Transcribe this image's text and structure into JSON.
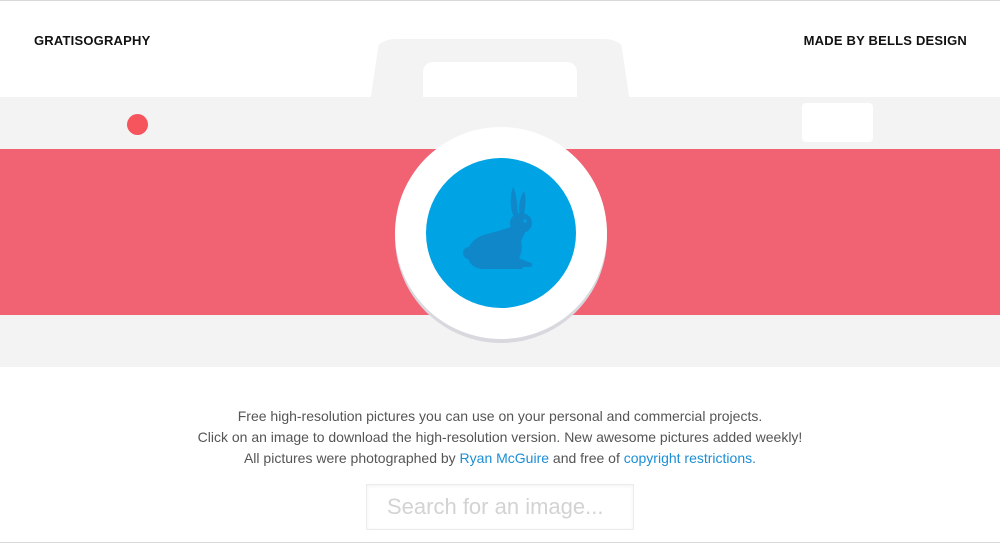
{
  "header": {
    "brand": "GRATISOGRAPHY",
    "made_by": "MADE BY BELLS DESIGN"
  },
  "hero": {
    "lens_icon": "rabbit-icon",
    "colors": {
      "band": "#f16273",
      "body": "#f4f3f4",
      "lens": "#00a3e3",
      "dot": "#f6555d"
    }
  },
  "intro": {
    "line1": "Free high-resolution pictures you can use on your personal and commercial projects.",
    "line2": "Click on an image to download the high-resolution version. New awesome pictures added weekly!",
    "line3_before": "All pictures were photographed by ",
    "photographer_link": "Ryan McGuire",
    "line3_middle": " and free of ",
    "copyright_link": "copyright restrictions."
  },
  "search": {
    "placeholder": "Search for an image...",
    "value": ""
  }
}
